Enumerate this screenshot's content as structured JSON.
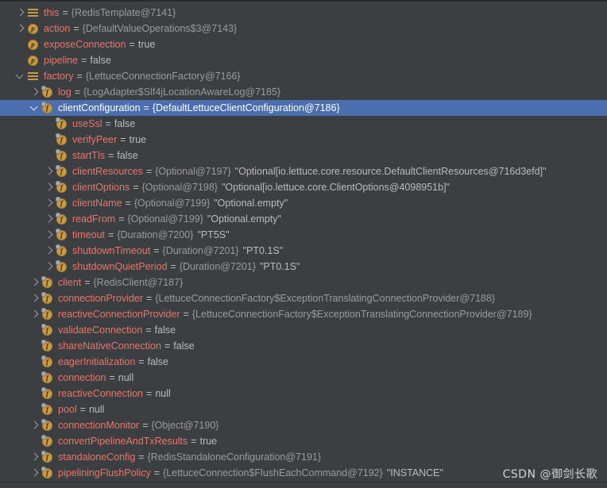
{
  "panel": {
    "title": "Debugger Variables",
    "colors": {
      "background": "#3c3f41",
      "selection": "#4b6eaf",
      "name": "#e8756a",
      "reference": "#9a9a9a",
      "value": "#bbbbbb",
      "icon_gold": "#c99a3f",
      "top_border": "#2b2b2b"
    }
  },
  "watermark": {
    "text": "CSDN @御剑长歌"
  },
  "rows": [
    {
      "depth": 0,
      "expander": "collapsed",
      "icon": "local-variable-icon",
      "name": "this",
      "eq": "=",
      "ref": "{RedisTemplate@7141}",
      "value": "",
      "string": "",
      "selected": false
    },
    {
      "depth": 0,
      "expander": "collapsed",
      "icon": "parameter-icon",
      "name": "action",
      "eq": "=",
      "ref": "{DefaultValueOperations$3@7143}",
      "value": "",
      "string": "",
      "selected": false
    },
    {
      "depth": 0,
      "expander": "none",
      "icon": "parameter-icon",
      "name": "exposeConnection",
      "eq": "=",
      "ref": "",
      "value": "true",
      "string": "",
      "selected": false
    },
    {
      "depth": 0,
      "expander": "none",
      "icon": "parameter-icon",
      "name": "pipeline",
      "eq": "=",
      "ref": "",
      "value": "false",
      "string": "",
      "selected": false
    },
    {
      "depth": 0,
      "expander": "expanded",
      "icon": "local-variable-icon",
      "name": "factory",
      "eq": "=",
      "ref": "{LettuceConnectionFactory@7166}",
      "value": "",
      "string": "",
      "selected": false
    },
    {
      "depth": 1,
      "expander": "collapsed",
      "icon": "private-field-icon",
      "name": "log",
      "eq": "=",
      "ref": "{LogAdapter$Slf4jLocationAwareLog@7185}",
      "value": "",
      "string": "",
      "selected": false
    },
    {
      "depth": 1,
      "expander": "expanded",
      "icon": "private-field-icon",
      "name": "clientConfiguration",
      "eq": "=",
      "ref": "{DefaultLettuceClientConfiguration@7186}",
      "value": "",
      "string": "",
      "selected": true
    },
    {
      "depth": 2,
      "expander": "none",
      "icon": "private-field-icon",
      "name": "useSsl",
      "eq": "=",
      "ref": "",
      "value": "false",
      "string": "",
      "selected": false
    },
    {
      "depth": 2,
      "expander": "none",
      "icon": "private-field-icon",
      "name": "verifyPeer",
      "eq": "=",
      "ref": "",
      "value": "true",
      "string": "",
      "selected": false
    },
    {
      "depth": 2,
      "expander": "none",
      "icon": "private-field-icon",
      "name": "startTls",
      "eq": "=",
      "ref": "",
      "value": "false",
      "string": "",
      "selected": false
    },
    {
      "depth": 2,
      "expander": "collapsed",
      "icon": "private-field-icon",
      "name": "clientResources",
      "eq": "=",
      "ref": "{Optional@7197}",
      "value": "",
      "string": "\"Optional[io.lettuce.core.resource.DefaultClientResources@716d3efd]\"",
      "selected": false
    },
    {
      "depth": 2,
      "expander": "collapsed",
      "icon": "private-field-icon",
      "name": "clientOptions",
      "eq": "=",
      "ref": "{Optional@7198}",
      "value": "",
      "string": "\"Optional[io.lettuce.core.ClientOptions@4098951b]\"",
      "selected": false
    },
    {
      "depth": 2,
      "expander": "collapsed",
      "icon": "private-field-icon",
      "name": "clientName",
      "eq": "=",
      "ref": "{Optional@7199}",
      "value": "",
      "string": "\"Optional.empty\"",
      "selected": false
    },
    {
      "depth": 2,
      "expander": "collapsed",
      "icon": "private-field-icon",
      "name": "readFrom",
      "eq": "=",
      "ref": "{Optional@7199}",
      "value": "",
      "string": "\"Optional.empty\"",
      "selected": false
    },
    {
      "depth": 2,
      "expander": "collapsed",
      "icon": "private-field-icon",
      "name": "timeout",
      "eq": "=",
      "ref": "{Duration@7200}",
      "value": "",
      "string": "\"PT5S\"",
      "selected": false
    },
    {
      "depth": 2,
      "expander": "collapsed",
      "icon": "private-field-icon",
      "name": "shutdownTimeout",
      "eq": "=",
      "ref": "{Duration@7201}",
      "value": "",
      "string": "\"PT0.1S\"",
      "selected": false
    },
    {
      "depth": 2,
      "expander": "collapsed",
      "icon": "private-field-icon",
      "name": "shutdownQuietPeriod",
      "eq": "=",
      "ref": "{Duration@7201}",
      "value": "",
      "string": "\"PT0.1S\"",
      "selected": false
    },
    {
      "depth": 1,
      "expander": "collapsed",
      "icon": "private-field-icon",
      "name": "client",
      "eq": "=",
      "ref": "{RedisClient@7187}",
      "value": "",
      "string": "",
      "selected": false
    },
    {
      "depth": 1,
      "expander": "collapsed",
      "icon": "private-field-icon",
      "name": "connectionProvider",
      "eq": "=",
      "ref": "{LettuceConnectionFactory$ExceptionTranslatingConnectionProvider@7188}",
      "value": "",
      "string": "",
      "selected": false
    },
    {
      "depth": 1,
      "expander": "collapsed",
      "icon": "private-field-icon",
      "name": "reactiveConnectionProvider",
      "eq": "=",
      "ref": "{LettuceConnectionFactory$ExceptionTranslatingConnectionProvider@7189}",
      "value": "",
      "string": "",
      "selected": false
    },
    {
      "depth": 1,
      "expander": "none",
      "icon": "private-field-icon",
      "name": "validateConnection",
      "eq": "=",
      "ref": "",
      "value": "false",
      "string": "",
      "selected": false
    },
    {
      "depth": 1,
      "expander": "none",
      "icon": "private-field-icon",
      "name": "shareNativeConnection",
      "eq": "=",
      "ref": "",
      "value": "false",
      "string": "",
      "selected": false
    },
    {
      "depth": 1,
      "expander": "none",
      "icon": "private-field-icon",
      "name": "eagerInitialization",
      "eq": "=",
      "ref": "",
      "value": "false",
      "string": "",
      "selected": false
    },
    {
      "depth": 1,
      "expander": "none",
      "icon": "private-field-icon",
      "name": "connection",
      "eq": "=",
      "ref": "",
      "value": "null",
      "string": "",
      "selected": false
    },
    {
      "depth": 1,
      "expander": "none",
      "icon": "private-field-icon",
      "name": "reactiveConnection",
      "eq": "=",
      "ref": "",
      "value": "null",
      "string": "",
      "selected": false
    },
    {
      "depth": 1,
      "expander": "none",
      "icon": "private-field-icon",
      "name": "pool",
      "eq": "=",
      "ref": "",
      "value": "null",
      "string": "",
      "selected": false
    },
    {
      "depth": 1,
      "expander": "collapsed",
      "icon": "private-field-icon",
      "name": "connectionMonitor",
      "eq": "=",
      "ref": "{Object@7190}",
      "value": "",
      "string": "",
      "selected": false
    },
    {
      "depth": 1,
      "expander": "none",
      "icon": "private-field-icon",
      "name": "convertPipelineAndTxResults",
      "eq": "=",
      "ref": "",
      "value": "true",
      "string": "",
      "selected": false
    },
    {
      "depth": 1,
      "expander": "collapsed",
      "icon": "private-field-icon",
      "name": "standaloneConfig",
      "eq": "=",
      "ref": "{RedisStandaloneConfiguration@7191}",
      "value": "",
      "string": "",
      "selected": false
    },
    {
      "depth": 1,
      "expander": "collapsed",
      "icon": "private-field-icon",
      "name": "pipeliningFlushPolicy",
      "eq": "=",
      "ref": "{LettuceConnection$FlushEachCommand@7192}",
      "value": "",
      "string": "\"INSTANCE\"",
      "selected": false
    }
  ]
}
